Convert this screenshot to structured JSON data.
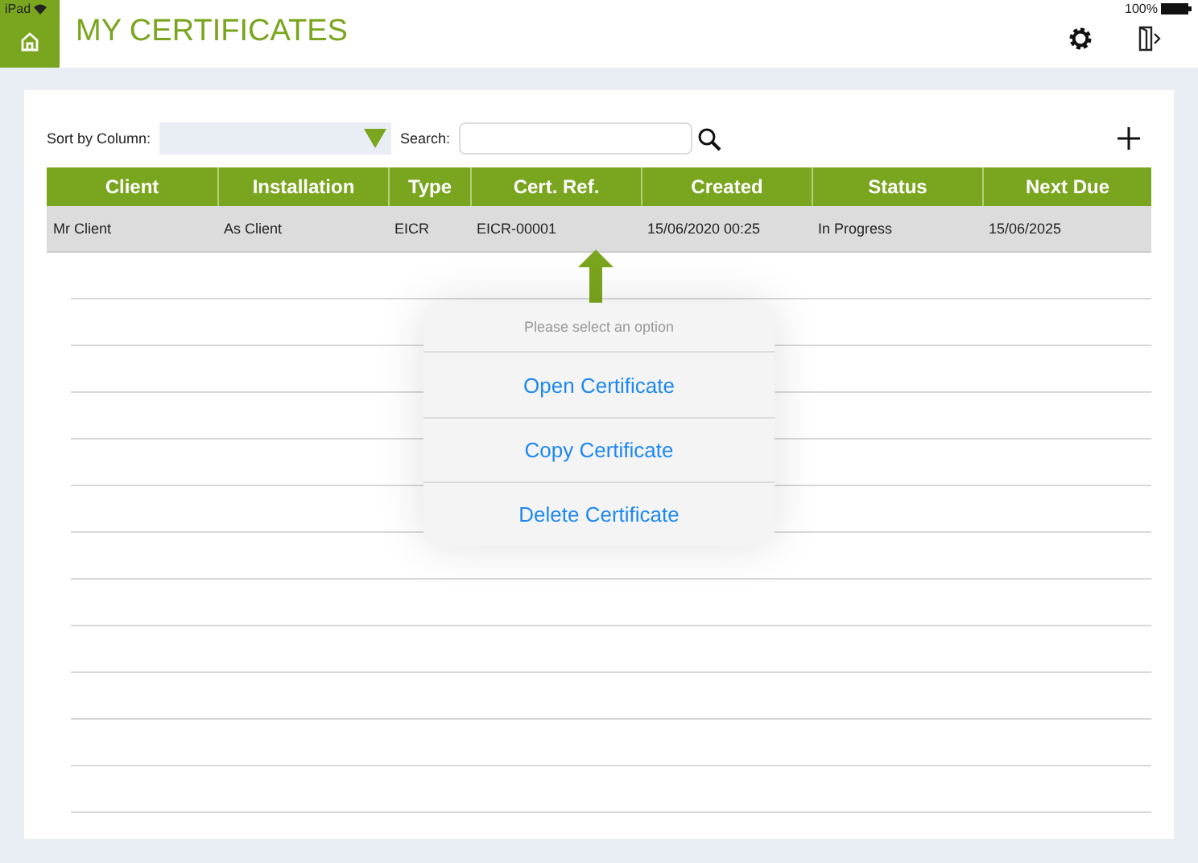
{
  "status_bar": {
    "device": "iPad",
    "battery": "100%"
  },
  "header": {
    "title": "MY CERTIFICATES"
  },
  "toolbar": {
    "sort_label": "Sort by Column:",
    "search_label": "Search:"
  },
  "table": {
    "columns": [
      "Client",
      "Installation",
      "Type",
      "Cert. Ref.",
      "Created",
      "Status",
      "Next Due"
    ],
    "rows": [
      {
        "selected": true,
        "cells": [
          "Mr Client",
          "As Client",
          "EICR",
          "EICR-00001",
          "15/06/2020 00:25",
          "In Progress",
          "15/06/2025"
        ]
      }
    ]
  },
  "popover": {
    "title": "Please select an option",
    "options": [
      "Open Certificate",
      "Copy Certificate",
      "Delete Certificate"
    ]
  }
}
